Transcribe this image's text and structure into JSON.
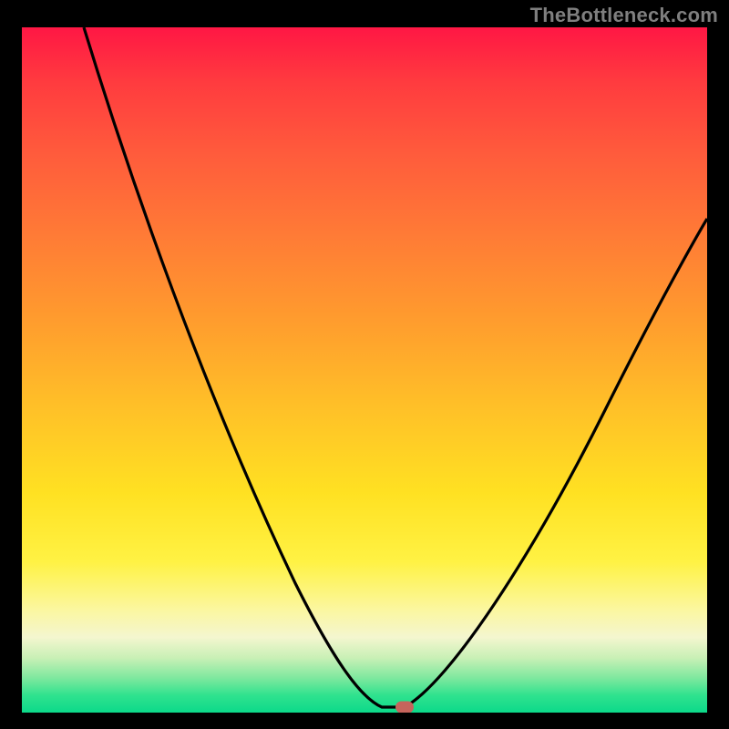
{
  "watermark": "TheBottleneck.com",
  "colors": {
    "background": "#000000",
    "gradient_top": "#ff1744",
    "gradient_mid": "#ffe122",
    "gradient_bottom": "#0cd98a",
    "curve": "#000000",
    "marker": "#c6645c",
    "watermark_text": "#7f7f7f"
  },
  "chart_data": {
    "type": "line",
    "title": "",
    "xlabel": "",
    "ylabel": "",
    "xlim": [
      0,
      100
    ],
    "ylim": [
      0,
      100
    ],
    "x": [
      9,
      15,
      22,
      30,
      38,
      45,
      50,
      53,
      56,
      60,
      66,
      74,
      82,
      90,
      100
    ],
    "values": [
      100,
      82,
      65,
      48,
      32,
      18,
      8,
      2,
      0,
      2,
      10,
      26,
      44,
      60,
      72
    ],
    "marker": {
      "x": 56,
      "y": 0
    },
    "notes": "V-shaped bottleneck curve over red-to-green vertical gradient; minimum marked by small rounded capsule near x≈56%."
  }
}
